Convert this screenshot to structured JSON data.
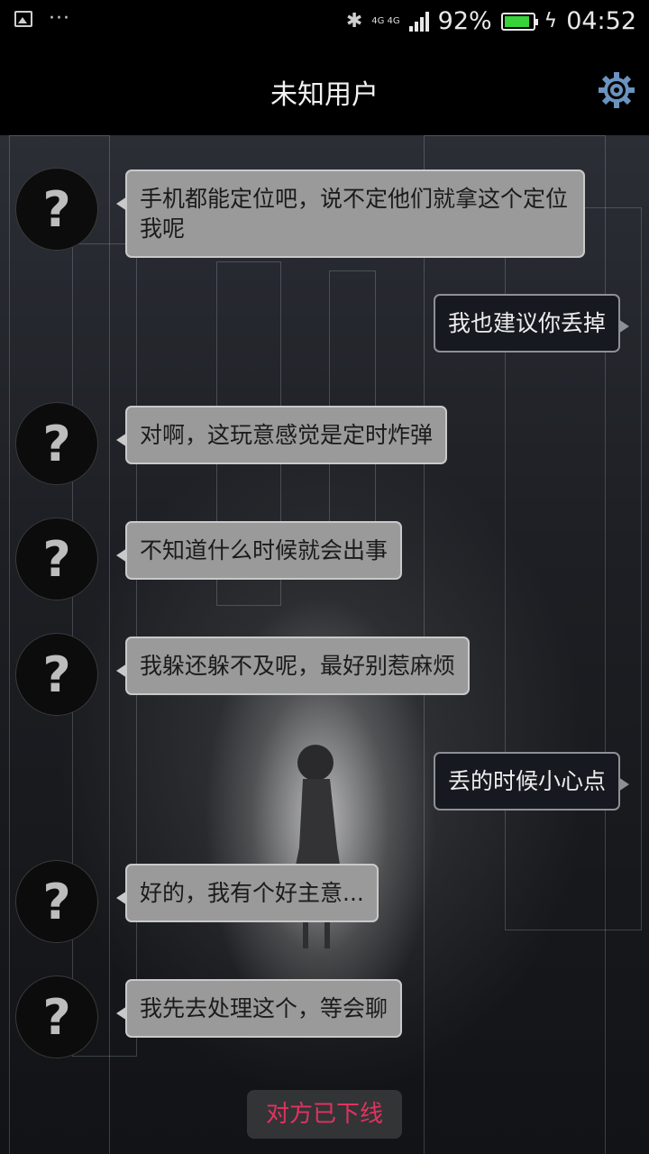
{
  "status_bar": {
    "network_top": "4G 4G",
    "battery_percent": "92%",
    "battery_level": 0.92,
    "time": "04:52",
    "battery_color": "#38d23a"
  },
  "header": {
    "title": "未知用户"
  },
  "avatar_glyph": "?",
  "messages": [
    {
      "from": "other",
      "text": "手机都能定位吧，说不定他们就拿这个定位我呢"
    },
    {
      "from": "me",
      "text": "我也建议你丢掉"
    },
    {
      "from": "other",
      "text": "对啊，这玩意感觉是定时炸弹"
    },
    {
      "from": "other",
      "text": "不知道什么时候就会出事"
    },
    {
      "from": "other",
      "text": "我躲还躲不及呢，最好别惹麻烦"
    },
    {
      "from": "me",
      "text": "丢的时候小心点"
    },
    {
      "from": "other",
      "text": "好的，我有个好主意..."
    },
    {
      "from": "other",
      "text": "我先去处理这个，等会聊"
    }
  ],
  "status_notice": "对方已下线",
  "colors": {
    "notice": "#e0335f",
    "incoming_bubble": "#9a9a9a",
    "outgoing_bubble": "#16191f"
  },
  "icons": [
    "image-icon",
    "more-dots-icon",
    "bluetooth-icon",
    "signal-icon",
    "battery-icon",
    "charging-icon",
    "settings-gear-icon",
    "unknown-avatar-icon"
  ]
}
